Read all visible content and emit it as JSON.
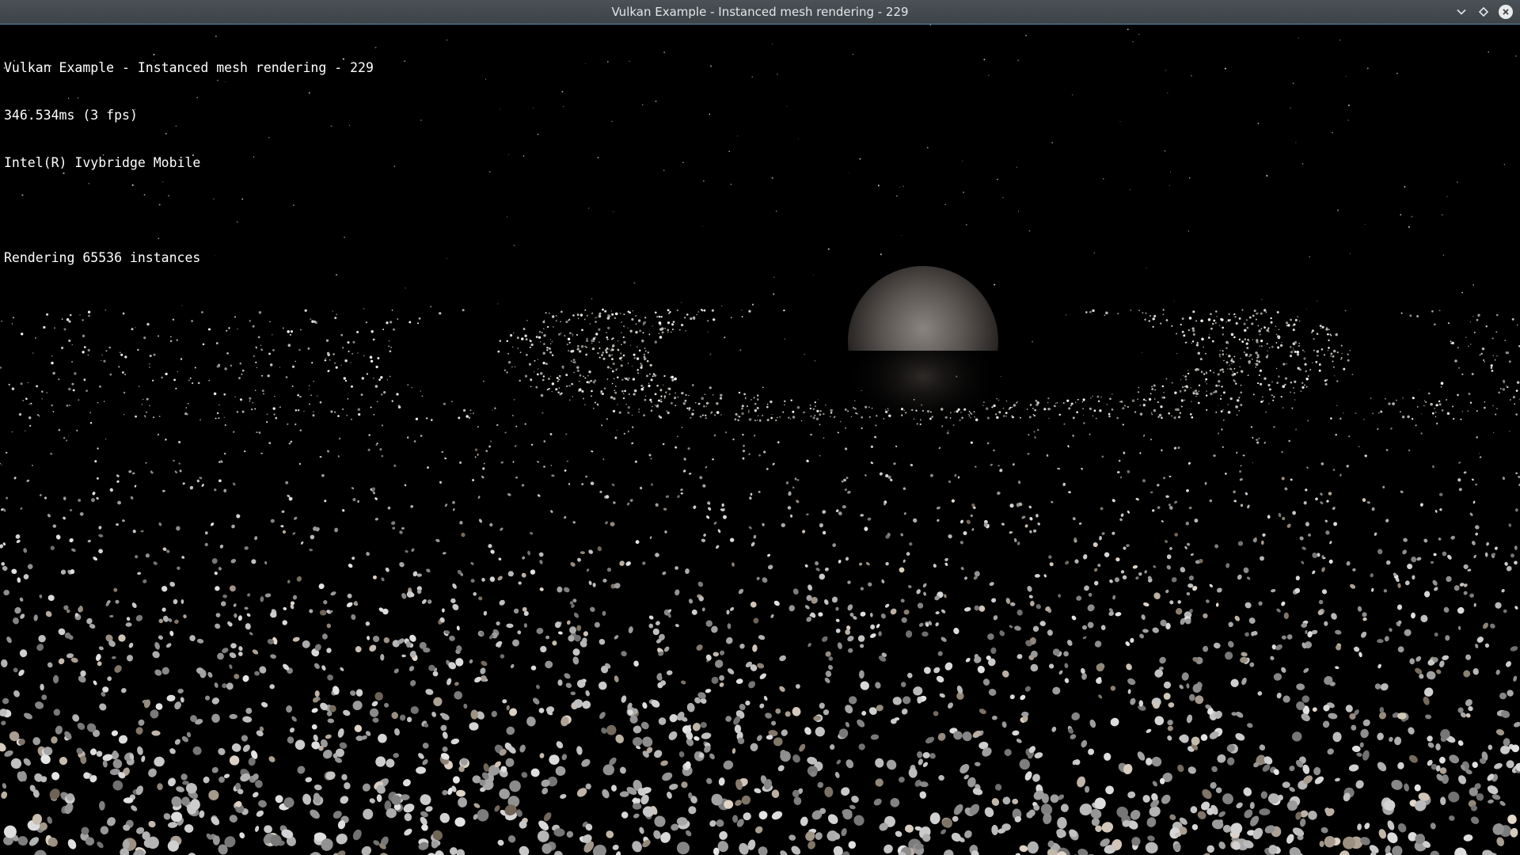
{
  "window": {
    "title": "Vulkan Example - Instanced mesh rendering - 229",
    "controls": {
      "minimize_icon": "chevron-down-icon",
      "maximize_icon": "diamond-icon",
      "close_icon": "close-icon"
    }
  },
  "overlay": {
    "title_line": "Vulkan Example - Instanced mesh rendering - 229",
    "frame_time": "346.534ms (3 fps)",
    "device_name": "Intel(R) Ivybridge Mobile",
    "instance_info": "Rendering 65536 instances"
  },
  "colors": {
    "background": "#000000",
    "titlebar": "#3f464b",
    "titlebar_accent": "#5a8fb0",
    "overlay_text": "#ffffff"
  }
}
